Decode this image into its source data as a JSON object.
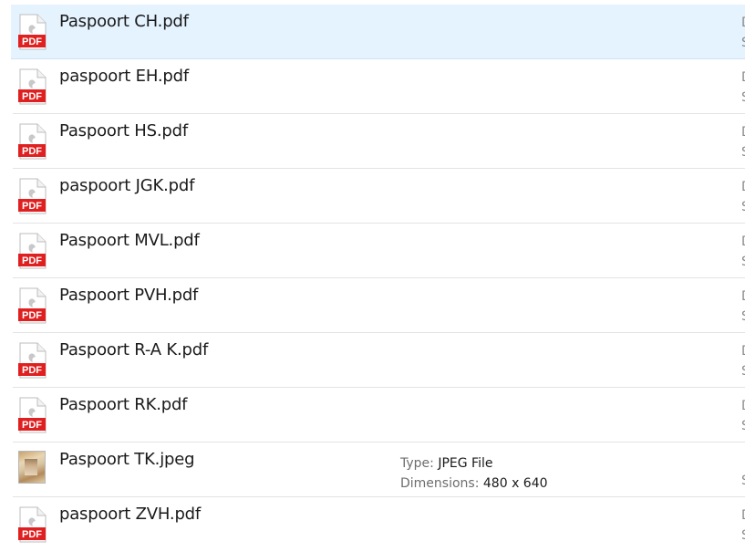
{
  "files": [
    {
      "name": "Paspoort CH.pdf",
      "type": "pdf",
      "selected": true
    },
    {
      "name": "paspoort EH.pdf",
      "type": "pdf"
    },
    {
      "name": "Paspoort HS.pdf",
      "type": "pdf"
    },
    {
      "name": "paspoort JGK.pdf",
      "type": "pdf"
    },
    {
      "name": "Paspoort MVL.pdf",
      "type": "pdf"
    },
    {
      "name": "Paspoort PVH.pdf",
      "type": "pdf"
    },
    {
      "name": "Paspoort R-A K.pdf",
      "type": "pdf"
    },
    {
      "name": "Paspoort RK.pdf",
      "type": "pdf"
    },
    {
      "name": "Paspoort TK.jpeg",
      "type": "jpeg",
      "details": {
        "type_label": "Type:",
        "type_value": "JPEG File",
        "dimensions_label": "Dimensions:",
        "dimensions_value": "480 x 640"
      }
    },
    {
      "name": "paspoort ZVH.pdf",
      "type": "pdf"
    }
  ],
  "pdf_icon_label": "PDF",
  "colors": {
    "pdf_red": "#e02020",
    "selection_bg": "#e5f3ff",
    "separator": "#e3e3e3"
  },
  "icons": {
    "pdf": "pdf-file-icon",
    "jpeg": "image-thumbnail-icon"
  }
}
